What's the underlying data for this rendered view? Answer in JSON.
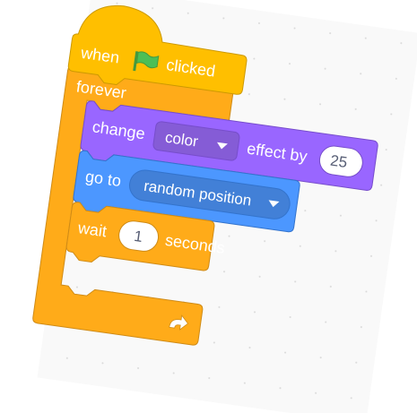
{
  "script": {
    "hat": {
      "label_when": "when",
      "label_clicked": "clicked",
      "icon": "green-flag-icon",
      "color": "#ffbf00"
    },
    "forever": {
      "label": "forever",
      "loop_icon": "loop-arrow-icon",
      "color": "#ffab19"
    },
    "change_effect": {
      "label_change": "change",
      "effect_value": "color",
      "label_effect_by": "effect by",
      "amount": "25",
      "color": "#9966ff"
    },
    "go_to": {
      "label": "go to",
      "target_value": "random position",
      "color": "#4c97ff"
    },
    "wait": {
      "label_wait": "wait",
      "duration": "1",
      "label_seconds": "seconds",
      "color": "#ffab19"
    }
  },
  "workspace": {
    "background": "#f9f9f9",
    "dot_color": "#d9d9d9"
  }
}
